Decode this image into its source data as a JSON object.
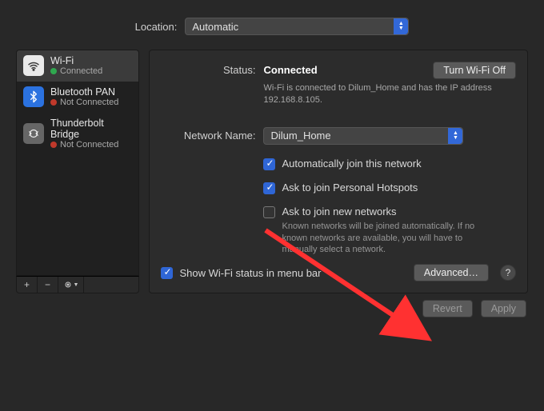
{
  "location": {
    "label": "Location:",
    "value": "Automatic"
  },
  "sidebar": {
    "interfaces": [
      {
        "name": "Wi-Fi",
        "status": "Connected",
        "status_color": "green",
        "icon": "wifi"
      },
      {
        "name": "Bluetooth PAN",
        "status": "Not Connected",
        "status_color": "red",
        "icon": "bluetooth"
      },
      {
        "name": "Thunderbolt Bridge",
        "status": "Not Connected",
        "status_color": "red",
        "icon": "thunderbolt"
      }
    ],
    "actions": {
      "add": "+",
      "remove": "−",
      "gear": "⚙"
    }
  },
  "main": {
    "status_label": "Status:",
    "status_value": "Connected",
    "toggle_wifi": "Turn Wi-Fi Off",
    "status_desc": "Wi-Fi is connected to Dilum_Home and has the IP address 192.168.8.105.",
    "network_label": "Network Name:",
    "network_value": "Dilum_Home",
    "check_auto_join": "Automatically join this network",
    "check_hotspot": "Ask to join Personal Hotspots",
    "check_new": "Ask to join new networks",
    "check_new_desc": "Known networks will be joined automatically. If no known networks are available, you will have to manually select a network.",
    "show_status": "Show Wi-Fi status in menu bar",
    "advanced": "Advanced…",
    "help": "?"
  },
  "footer": {
    "revert": "Revert",
    "apply": "Apply"
  }
}
